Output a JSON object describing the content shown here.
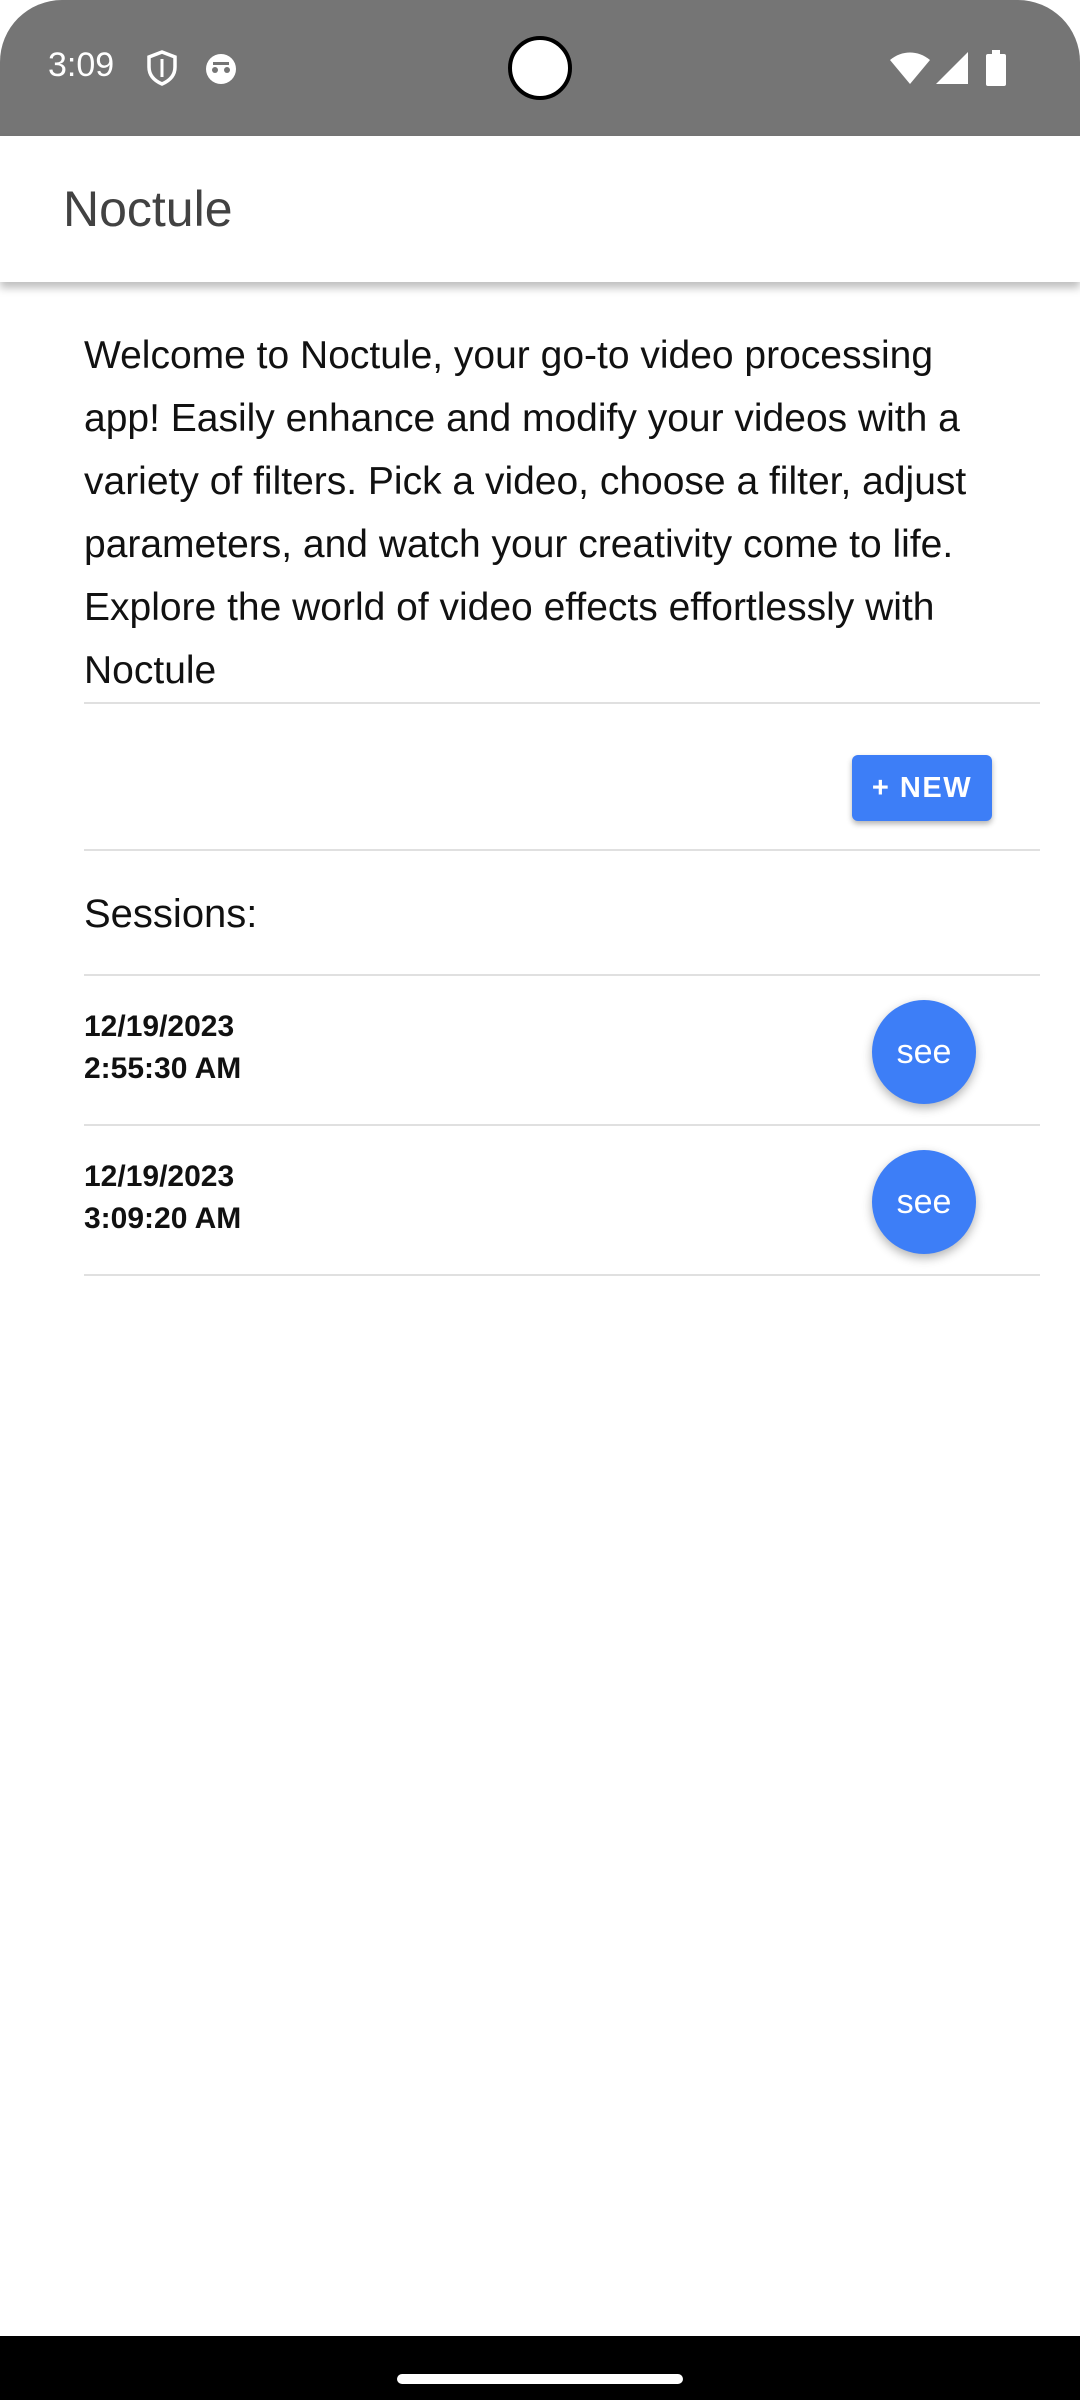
{
  "status_bar": {
    "time": "3:09",
    "icons": [
      "shield-icon",
      "cat-icon",
      "wifi-icon",
      "signal-icon",
      "battery-icon"
    ]
  },
  "app_bar": {
    "title": "Noctule"
  },
  "welcome_text": "Welcome to Noctule, your go-to video processing app! Easily enhance and modify your videos with a variety of filters. Pick a video, choose a filter, adjust parameters, and watch your creativity come to life. Explore the world of video effects effortlessly with Noctule",
  "new_button": {
    "label": "+ NEW"
  },
  "sessions": {
    "label": "Sessions:",
    "items": [
      {
        "date": "12/19/2023\n2:55:30 AM",
        "button": "see"
      },
      {
        "date": "12/19/2023\n3:09:20 AM",
        "button": "see"
      }
    ]
  },
  "colors": {
    "accent": "#3d7ef7",
    "status_bar": "#757575",
    "title": "#424242"
  }
}
